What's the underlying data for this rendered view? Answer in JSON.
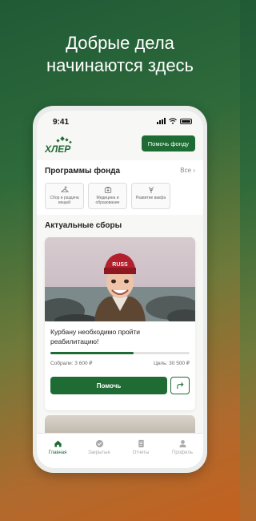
{
  "promo": {
    "headline_line1": "Добрые дела",
    "headline_line2": "начинаются здесь"
  },
  "status_bar": {
    "time": "9:41"
  },
  "header": {
    "logo_text": "ХЛЕР",
    "donate_button": "Помочь фонду"
  },
  "programs": {
    "title": "Программы фонда",
    "see_all": "Все",
    "items": [
      {
        "label": "Сбор и раздача вещей",
        "icon": "hanger-icon"
      },
      {
        "label": "Медицина и образование",
        "icon": "medical-icon"
      },
      {
        "label": "Развитие вакфа",
        "icon": "tree-icon"
      }
    ]
  },
  "fundraisers": {
    "title": "Актуальные сборы",
    "cards": [
      {
        "title": "Курбану необходимо пройти реабилитацию!",
        "collected": "Собрали: 3 600 ₽",
        "goal": "Цель: 30 500 ₽",
        "progress": 0.6,
        "help_button": "Помочь"
      }
    ]
  },
  "tabbar": {
    "items": [
      {
        "label": "Главная",
        "icon": "home-icon",
        "active": true
      },
      {
        "label": "Закрытые",
        "icon": "check-circle-icon",
        "active": false
      },
      {
        "label": "Отчеты",
        "icon": "document-icon",
        "active": false
      },
      {
        "label": "Профиль",
        "icon": "user-icon",
        "active": false
      }
    ]
  },
  "colors": {
    "accent": "#1e6b33"
  }
}
